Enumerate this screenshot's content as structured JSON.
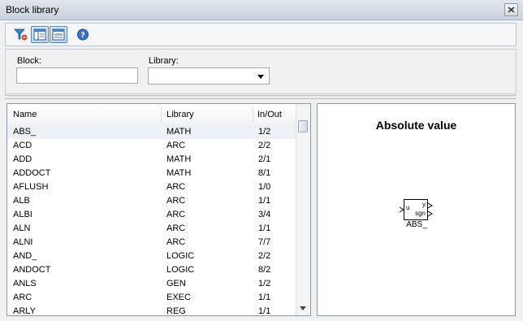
{
  "window": {
    "title": "Block library"
  },
  "toolbar": {
    "buttons": [
      {
        "icon": "filter-icon"
      },
      {
        "icon": "columns-view-icon"
      },
      {
        "icon": "layout-view-icon"
      },
      {
        "icon": "help-icon"
      }
    ]
  },
  "filter": {
    "block_label": "Block:",
    "block_value": "",
    "library_label": "Library:",
    "library_value": ""
  },
  "list": {
    "columns": [
      "Name",
      "Library",
      "In/Out"
    ],
    "rows": [
      {
        "name": "ABS_",
        "library": "MATH",
        "io": "1/2"
      },
      {
        "name": "ACD",
        "library": "ARC",
        "io": "2/2"
      },
      {
        "name": "ADD",
        "library": "MATH",
        "io": "2/1"
      },
      {
        "name": "ADDOCT",
        "library": "MATH",
        "io": "8/1"
      },
      {
        "name": "AFLUSH",
        "library": "ARC",
        "io": "1/0"
      },
      {
        "name": "ALB",
        "library": "ARC",
        "io": "1/1"
      },
      {
        "name": "ALBI",
        "library": "ARC",
        "io": "3/4"
      },
      {
        "name": "ALN",
        "library": "ARC",
        "io": "1/1"
      },
      {
        "name": "ALNI",
        "library": "ARC",
        "io": "7/7"
      },
      {
        "name": "AND_",
        "library": "LOGIC",
        "io": "2/2"
      },
      {
        "name": "ANDOCT",
        "library": "LOGIC",
        "io": "8/2"
      },
      {
        "name": "ANLS",
        "library": "GEN",
        "io": "1/2"
      },
      {
        "name": "ARC",
        "library": "EXEC",
        "io": "1/1"
      },
      {
        "name": "ARLY",
        "library": "REG",
        "io": "1/1"
      }
    ],
    "selected_index": 0
  },
  "preview": {
    "title": "Absolute value",
    "block": {
      "name": "ABS_",
      "input": "u",
      "output_y": "y",
      "output_sgn": "sgn"
    }
  }
}
